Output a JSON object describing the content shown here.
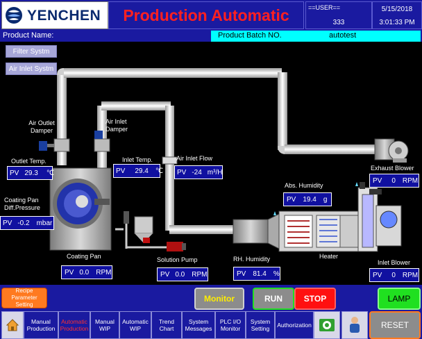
{
  "header": {
    "logo": "YENCHEN",
    "title": "Production Automatic",
    "user_label": "==USER==",
    "user_id": "333",
    "date": "5/15/2018",
    "time": "3:01:33 PM"
  },
  "product": {
    "name_label": "Product Name:",
    "batch_label": "Product Batch NO.",
    "batch_value": "autotest"
  },
  "menu": {
    "filter": "Filter Systm",
    "air_inlet": "Air Inlet Systm"
  },
  "labels": {
    "air_outlet_damper_1": "Air Outlet",
    "air_outlet_damper_2": "Damper",
    "air_inlet_damper_1": "Air Inlet",
    "air_inlet_damper_2": "Damper",
    "outlet_temp": "Outlet Temp.",
    "inlet_temp": "Inlet Temp.",
    "air_inlet_flow": "Air Inlet Flow",
    "exhaust_blower": "Exhaust Blower",
    "abs_humidity": "Abs. Humidity",
    "coating_pan_diff_1": "Coating Pan",
    "coating_pan_diff_2": "Diff.Pressure",
    "coating_pan": "Coating Pan",
    "solution_pump": "Solution Pump",
    "rh_humidity": "RH. Humidity",
    "heater": "Heater",
    "inlet_blower": "Inlet Blower"
  },
  "readings": {
    "outlet_temp": {
      "prefix": "PV",
      "value": "29.3",
      "unit": "℃"
    },
    "inlet_temp": {
      "prefix": "PV",
      "value": "29.4",
      "unit": "℃"
    },
    "air_inlet_flow": {
      "prefix": "PV",
      "value": "-24",
      "unit": "m³/H"
    },
    "exhaust_blower": {
      "prefix": "PV",
      "value": "0",
      "unit": "RPM"
    },
    "abs_humidity": {
      "prefix": "PV",
      "value": "19.4",
      "unit": "g"
    },
    "coating_pan_diff": {
      "prefix": "PV",
      "value": "-0.2",
      "unit": "mbar"
    },
    "coating_pan": {
      "prefix": "PV",
      "value": "0.0",
      "unit": "RPM"
    },
    "solution_pump": {
      "prefix": "PV",
      "value": "0.0",
      "unit": "RPM"
    },
    "rh_humidity": {
      "prefix": "PV",
      "value": "81.4",
      "unit": "%"
    },
    "inlet_blower": {
      "prefix": "PV",
      "value": "0",
      "unit": "RPM"
    }
  },
  "controls": {
    "recipe": "Recipe Parameter Setting",
    "monitor": "Monitor",
    "run": "RUN",
    "stop": "STOP",
    "lamp": "LAMP",
    "reset": "RESET"
  },
  "nav": [
    "Manual Production",
    "Automatic Production",
    "Manual WIP",
    "Automatic WIP",
    "Trend Chart",
    "System Messages",
    "PLC I/O Monitor",
    "System Setting",
    "Authorization"
  ],
  "colors": {
    "panel_blue": "#1a1aa0",
    "title_red": "#ff2020",
    "cyan": "#00ffff",
    "run_green": "#20e020",
    "stop_red": "#ff1010",
    "active_nav": "#ff3030"
  }
}
